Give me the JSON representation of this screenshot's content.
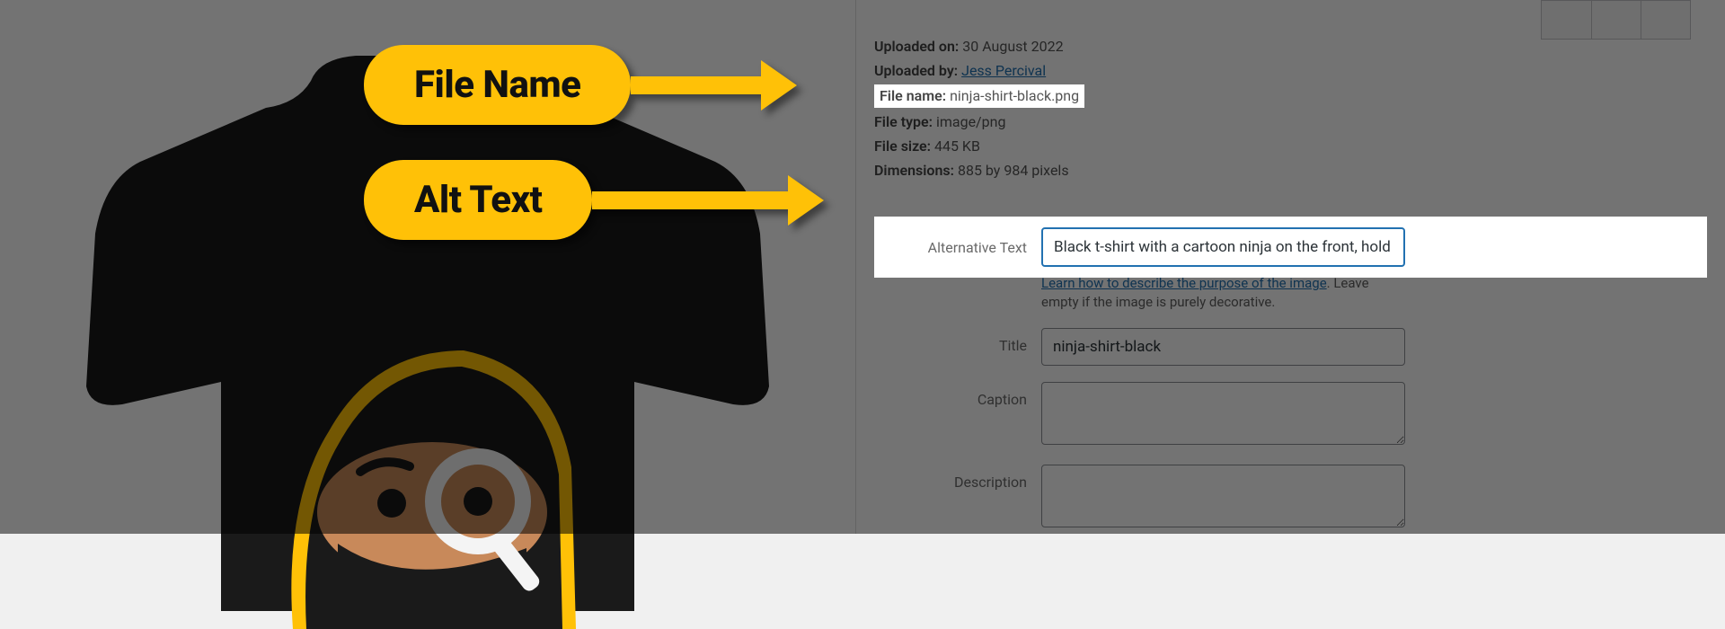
{
  "callouts": {
    "file_name": "File Name",
    "alt_text": "Alt Text"
  },
  "meta": {
    "uploaded_on_label": "Uploaded on:",
    "uploaded_on_value": "30 August 2022",
    "uploaded_by_label": "Uploaded by:",
    "uploaded_by_value": "Jess Percival",
    "file_name_label": "File name:",
    "file_name_value": "ninja-shirt-black.png",
    "file_type_label": "File type:",
    "file_type_value": "image/png",
    "file_size_label": "File size:",
    "file_size_value": "445 KB",
    "dimensions_label": "Dimensions:",
    "dimensions_value": "885 by 984 pixels"
  },
  "form": {
    "alt_label": "Alternative Text",
    "alt_value": "Black t-shirt with a cartoon ninja on the front, hold",
    "alt_hint_link": "Learn how to describe the purpose of the image",
    "alt_hint_tail": ". Leave empty if the image is purely decorative.",
    "title_label": "Title",
    "title_value": "ninja-shirt-black",
    "caption_label": "Caption",
    "caption_value": "",
    "description_label": "Description",
    "description_value": ""
  }
}
